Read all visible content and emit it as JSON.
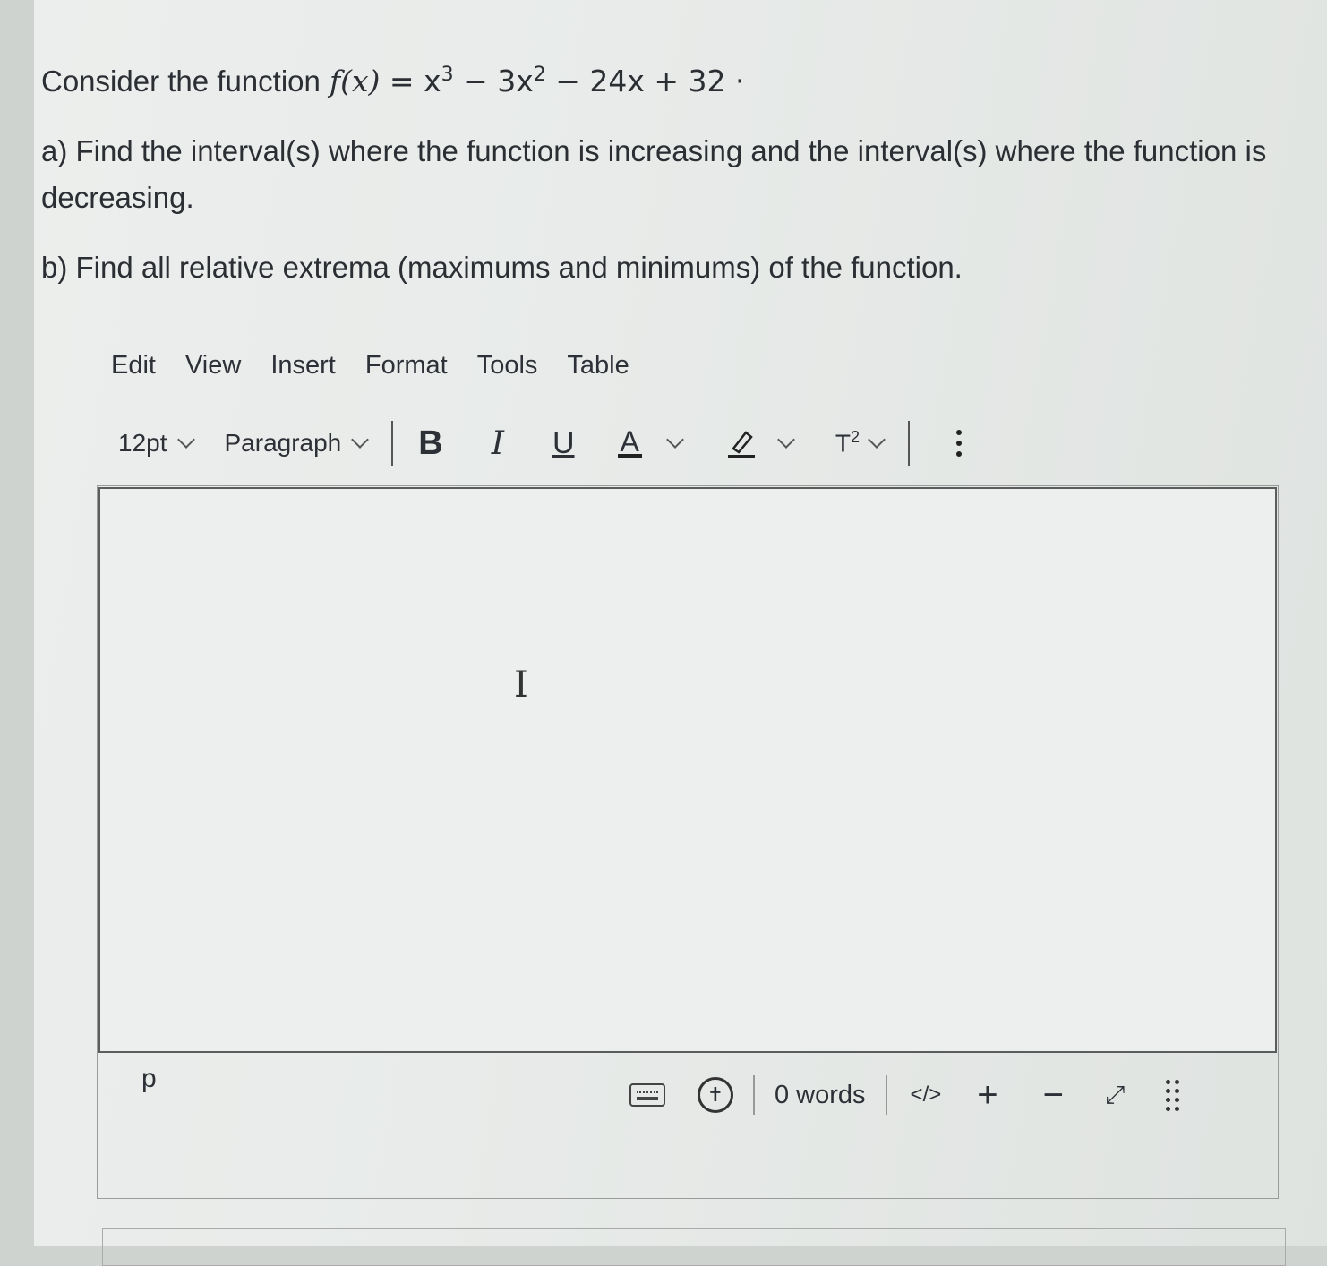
{
  "question": {
    "intro": "Consider the function",
    "function": {
      "name": "f(x)",
      "eq": " = x",
      "exp3": "3",
      "mid": " − 3x",
      "exp2": "2",
      "tail": " − 24x + 32 ·"
    },
    "part_a": "a) Find the interval(s) where the function is increasing and the interval(s) where the function is decreasing.",
    "part_b": "b) Find all relative extrema (maximums and minimums) of the function."
  },
  "menubar": [
    "Edit",
    "View",
    "Insert",
    "Format",
    "Tools",
    "Table"
  ],
  "toolbar": {
    "font_size": "12pt",
    "block_format": "Paragraph",
    "bold": "B",
    "italic": "I",
    "underline": "U",
    "text_color": "A",
    "superscript_base": "T",
    "superscript_exp": "2"
  },
  "status": {
    "path": "p",
    "word_count": "0 words",
    "html_toggle": "</>",
    "zoom_in": "+",
    "zoom_out": "−",
    "fullscreen": "⤢"
  }
}
